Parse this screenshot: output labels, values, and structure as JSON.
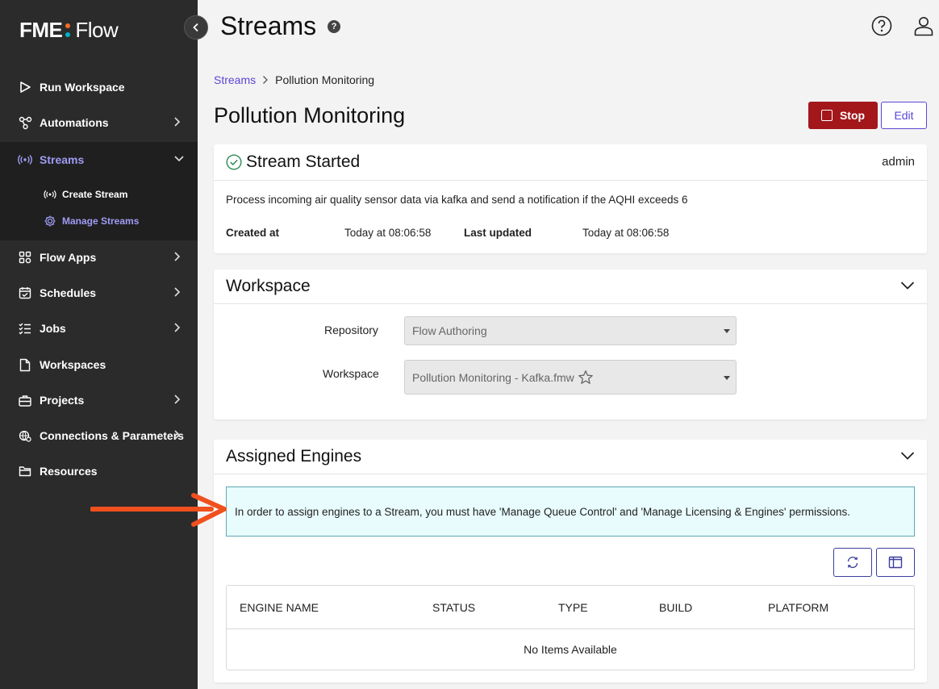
{
  "sidebar": {
    "logo": {
      "brand": "FME",
      "product": "Flow",
      "dot_colors": [
        "#f37021",
        "#00b2c6"
      ]
    },
    "items": [
      {
        "label": "Run Workspace",
        "icon": "play-outline-icon"
      },
      {
        "label": "Automations",
        "icon": "automations-icon",
        "has_children": true
      },
      {
        "label": "Streams",
        "icon": "broadcast-icon",
        "expanded": true,
        "active": true
      },
      {
        "label": "Flow Apps",
        "icon": "apps-grid-icon",
        "has_children": true
      },
      {
        "label": "Schedules",
        "icon": "calendar-icon",
        "has_children": true
      },
      {
        "label": "Jobs",
        "icon": "checklist-icon",
        "has_children": true
      },
      {
        "label": "Workspaces",
        "icon": "file-icon"
      },
      {
        "label": "Projects",
        "icon": "briefcase-icon",
        "has_children": true
      },
      {
        "label": "Connections & Parameters",
        "icon": "globe-gear-icon",
        "has_children": true
      },
      {
        "label": "Resources",
        "icon": "folder-icon"
      }
    ],
    "sub_items": [
      {
        "label": "Create Stream",
        "icon": "broadcast-icon"
      },
      {
        "label": "Manage Streams",
        "icon": "gear-icon",
        "active": true
      }
    ],
    "accent_color": "#9f9cf5"
  },
  "header": {
    "title": "Streams",
    "help_badge": "?"
  },
  "breadcrumb": {
    "root": "Streams",
    "current": "Pollution Monitoring"
  },
  "stream": {
    "title": "Pollution Monitoring",
    "stop_label": "Stop",
    "edit_label": "Edit",
    "status_label": "Stream Started",
    "owner": "admin",
    "description": "Process incoming air quality sensor data via kafka and send a notification if the AQHI exceeds 6",
    "created_label": "Created at",
    "created_value": "Today at 08:06:58",
    "updated_label": "Last updated",
    "updated_value": "Today at 08:06:58"
  },
  "workspace_section": {
    "title": "Workspace",
    "repository_label": "Repository",
    "repository_value": "Flow Authoring",
    "workspace_label": "Workspace",
    "workspace_value": "Pollution Monitoring - Kafka.fmw"
  },
  "engines_section": {
    "title": "Assigned Engines",
    "info_message": "In order to assign engines to a Stream, you must have 'Manage Queue Control' and 'Manage Licensing & Engines' permissions.",
    "columns": [
      "ENGINE NAME",
      "STATUS",
      "TYPE",
      "BUILD",
      "PLATFORM"
    ],
    "empty_message": "No Items Available"
  },
  "colors": {
    "stop": "#a3171b",
    "link": "#5a47d6",
    "success": "#2e8b57",
    "annotation_arrow": "#f0501e"
  }
}
